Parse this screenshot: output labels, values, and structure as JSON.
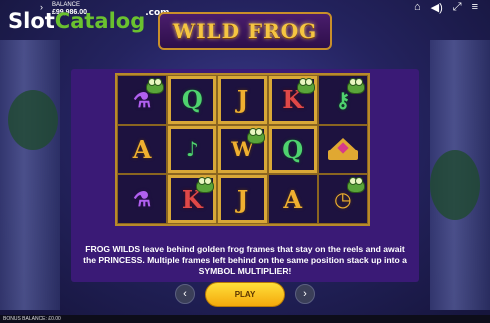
{
  "hud": {
    "balance_label": "BALANCE",
    "balance_value": "£99,986.00",
    "arrow": "›",
    "icons": [
      "home-icon",
      "sound-icon",
      "fullscreen-icon",
      "menu-icon"
    ],
    "icon_glyphs": [
      "⌂",
      "◀)",
      "⤢",
      "≡"
    ]
  },
  "watermark": {
    "slot": "Slot",
    "catalog": "Catalog",
    "com": ".com"
  },
  "title": "WILD FROG",
  "reels": [
    [
      {
        "symbol": "potion-icon",
        "glyph": "⚗",
        "color": "purple"
      },
      {
        "symbol": "A",
        "glyph": "A",
        "color": "gold"
      },
      {
        "symbol": "potion-icon",
        "glyph": "⚗",
        "color": "purple"
      }
    ],
    [
      {
        "symbol": "Q",
        "glyph": "Q",
        "color": "green"
      },
      {
        "symbol": "lute-icon",
        "glyph": "♪",
        "color": "green"
      },
      {
        "symbol": "K",
        "glyph": "K",
        "color": "red"
      }
    ],
    [
      {
        "symbol": "J",
        "glyph": "J",
        "color": "gold"
      },
      {
        "symbol": "wild-frog-icon",
        "glyph": "W",
        "color": "gold"
      },
      {
        "symbol": "J",
        "glyph": "J",
        "color": "gold"
      }
    ],
    [
      {
        "symbol": "K",
        "glyph": "K",
        "color": "red"
      },
      {
        "symbol": "Q",
        "glyph": "Q",
        "color": "green"
      },
      {
        "symbol": "A",
        "glyph": "A",
        "color": "gold"
      }
    ],
    [
      {
        "symbol": "key-icon",
        "glyph": "⚷",
        "color": "green"
      },
      {
        "symbol": "crown-icon",
        "glyph": "",
        "color": "gold"
      },
      {
        "symbol": "pocket-watch-icon",
        "glyph": "◷",
        "color": "gold"
      }
    ]
  ],
  "description": "FROG WILDS leave behind golden frog frames that stay on the reels and await the PRINCESS. Multiple frames left behind on the same position stack up into a SYMBOL MULTIPLIER!",
  "buttons": {
    "prev": "‹",
    "play": "PLAY",
    "next": "›"
  },
  "bottom": {
    "bonus_balance": "BONUS BALANCE: £0.00"
  },
  "colors": {
    "accent_gold": "#f5c542",
    "panel_purple": "#3a1a76",
    "play_yellow": "#ffdf3a",
    "logo_green": "#6ac12f"
  }
}
